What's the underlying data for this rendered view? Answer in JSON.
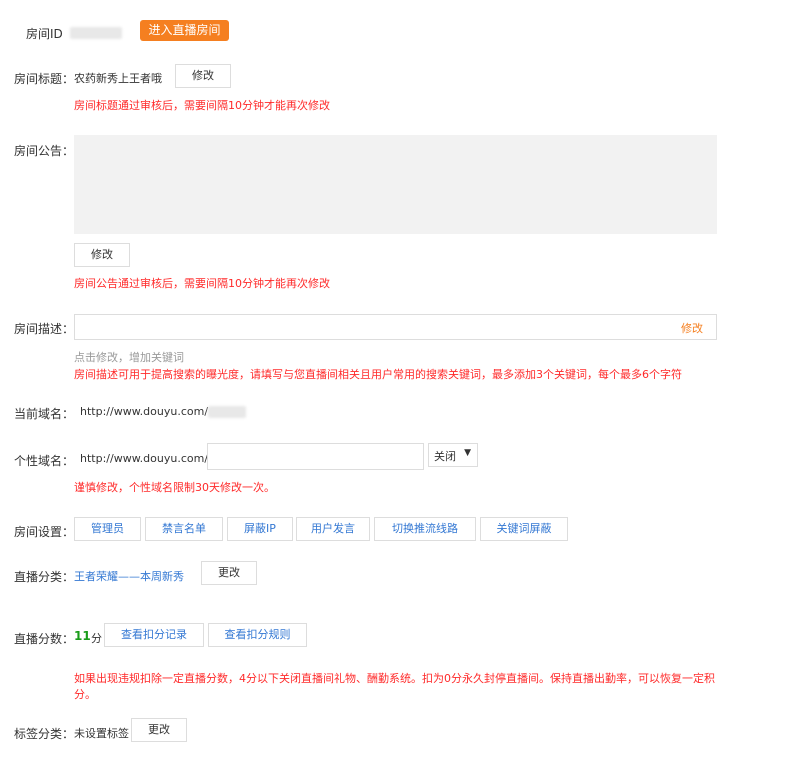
{
  "room_id": {
    "label": "房间ID",
    "enter_button": "进入直播房间"
  },
  "title": {
    "label": "房间标题：",
    "value": "农药新秀上王者哦",
    "edit_button": "修改",
    "warning": "房间标题通过审核后，需要间隔10分钟才能再次修改"
  },
  "notice": {
    "label": "房间公告：",
    "edit_button": "修改",
    "warning": "房间公告通过审核后，需要间隔10分钟才能再次修改"
  },
  "description": {
    "label": "房间描述：",
    "edit_link": "修改",
    "hint": "点击修改，增加关键词",
    "warning": "房间描述可用于提高搜索的曝光度，请填写与您直播间相关且用户常用的搜索关键词，最多添加3个关键词，每个最多6个字符"
  },
  "current_domain": {
    "label": "当前域名：",
    "prefix": "http://www.douyu.com/"
  },
  "custom_domain": {
    "label": "个性域名：",
    "prefix": "http://www.douyu.com/",
    "select_value": "关闭",
    "warning": "谨慎修改，个性域名限制30天修改一次。"
  },
  "room_settings": {
    "label": "房间设置：",
    "buttons": [
      "管理员",
      "禁言名单",
      "屏蔽IP",
      "用户发言",
      "切换推流线路",
      "关键词屏蔽"
    ]
  },
  "category": {
    "label": "直播分类：",
    "value": "王者荣耀——本周新秀",
    "change_button": "更改"
  },
  "score": {
    "label": "直播分数：",
    "value": "11",
    "unit": "分",
    "record_button": "查看扣分记录",
    "rules_button": "查看扣分规则",
    "warning_line1": "如果出现违规扣除一定直播分数，4分以下关闭直播间礼物、酬勤系统。扣为0分永久封停直播间。保持直播出勤率，可以恢复一定积",
    "warning_line2": "分。"
  },
  "tags": {
    "label": "标签分类：",
    "value": "未设置标签",
    "change_button": "更改"
  },
  "colors": {
    "accent": "#f57f20",
    "warning": "#ff2a2a",
    "link": "#3478d3",
    "score": "#1a9c1a"
  }
}
